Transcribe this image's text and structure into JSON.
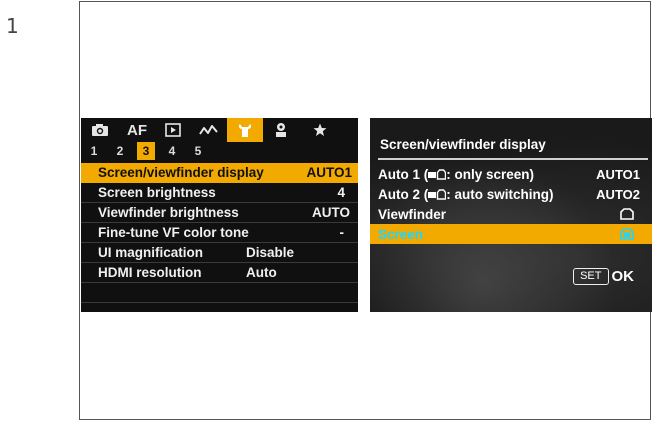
{
  "step": {
    "number": "1"
  },
  "menu": {
    "tab_labels": {
      "af": "AF"
    },
    "subtabs": [
      "1",
      "2",
      "3",
      "4",
      "5"
    ],
    "active_subtab_index": 2,
    "items": [
      {
        "label": "Screen/viewfinder display",
        "value": "AUTO1",
        "selected": true
      },
      {
        "label": "Screen brightness",
        "value": "4"
      },
      {
        "label": "Viewfinder brightness",
        "value": "AUTO"
      },
      {
        "label": "Fine-tune VF color tone",
        "value": "-"
      },
      {
        "label": "UI magnification",
        "value": "Disable"
      },
      {
        "label": "HDMI resolution",
        "value": "Auto"
      }
    ],
    "colors": {
      "accent": "#f2a900",
      "background": "#101010"
    }
  },
  "dialog": {
    "title": "Screen/viewfinder display",
    "options": [
      {
        "label": "Auto 1 (",
        "label_suffix": ": only screen)",
        "value": "AUTO1"
      },
      {
        "label": "Auto 2 (",
        "label_suffix": ": auto switching)",
        "value": "AUTO2"
      },
      {
        "label": "Viewfinder",
        "icon": "viewfinder-icon"
      },
      {
        "label": "Screen",
        "icon": "screen-icon",
        "selected": true
      }
    ],
    "footer": {
      "set_label": "SET",
      "ok_label": "OK"
    },
    "colors": {
      "highlight": "#f2a900",
      "selected_text": "#1fd6ff"
    }
  }
}
